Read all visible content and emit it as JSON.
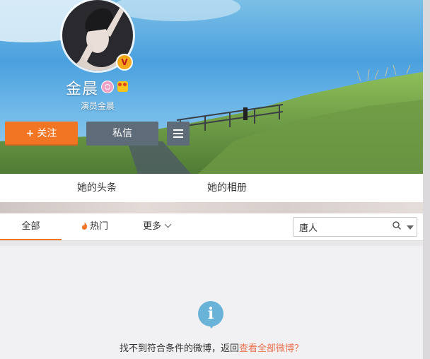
{
  "profile": {
    "name": "金晨",
    "bio": "演员金晨",
    "verified_badge": "V"
  },
  "actions": {
    "follow_label": "关注",
    "follow_plus": "+",
    "message_label": "私信"
  },
  "tabs": [
    {
      "label": "她的头条"
    },
    {
      "label": "她的相册"
    }
  ],
  "filter": {
    "all_label": "全部",
    "hot_label": "热门",
    "more_label": "更多",
    "search_value": "唐人"
  },
  "empty_state": {
    "icon_glyph": "i",
    "message": "找不到符合条件的微博，返回",
    "link_text": "查看全部微博？"
  },
  "colors": {
    "accent": "#f27524",
    "secondary_button": "#5e6b78",
    "link": "#eb7350",
    "info": "#6ab3d8"
  }
}
